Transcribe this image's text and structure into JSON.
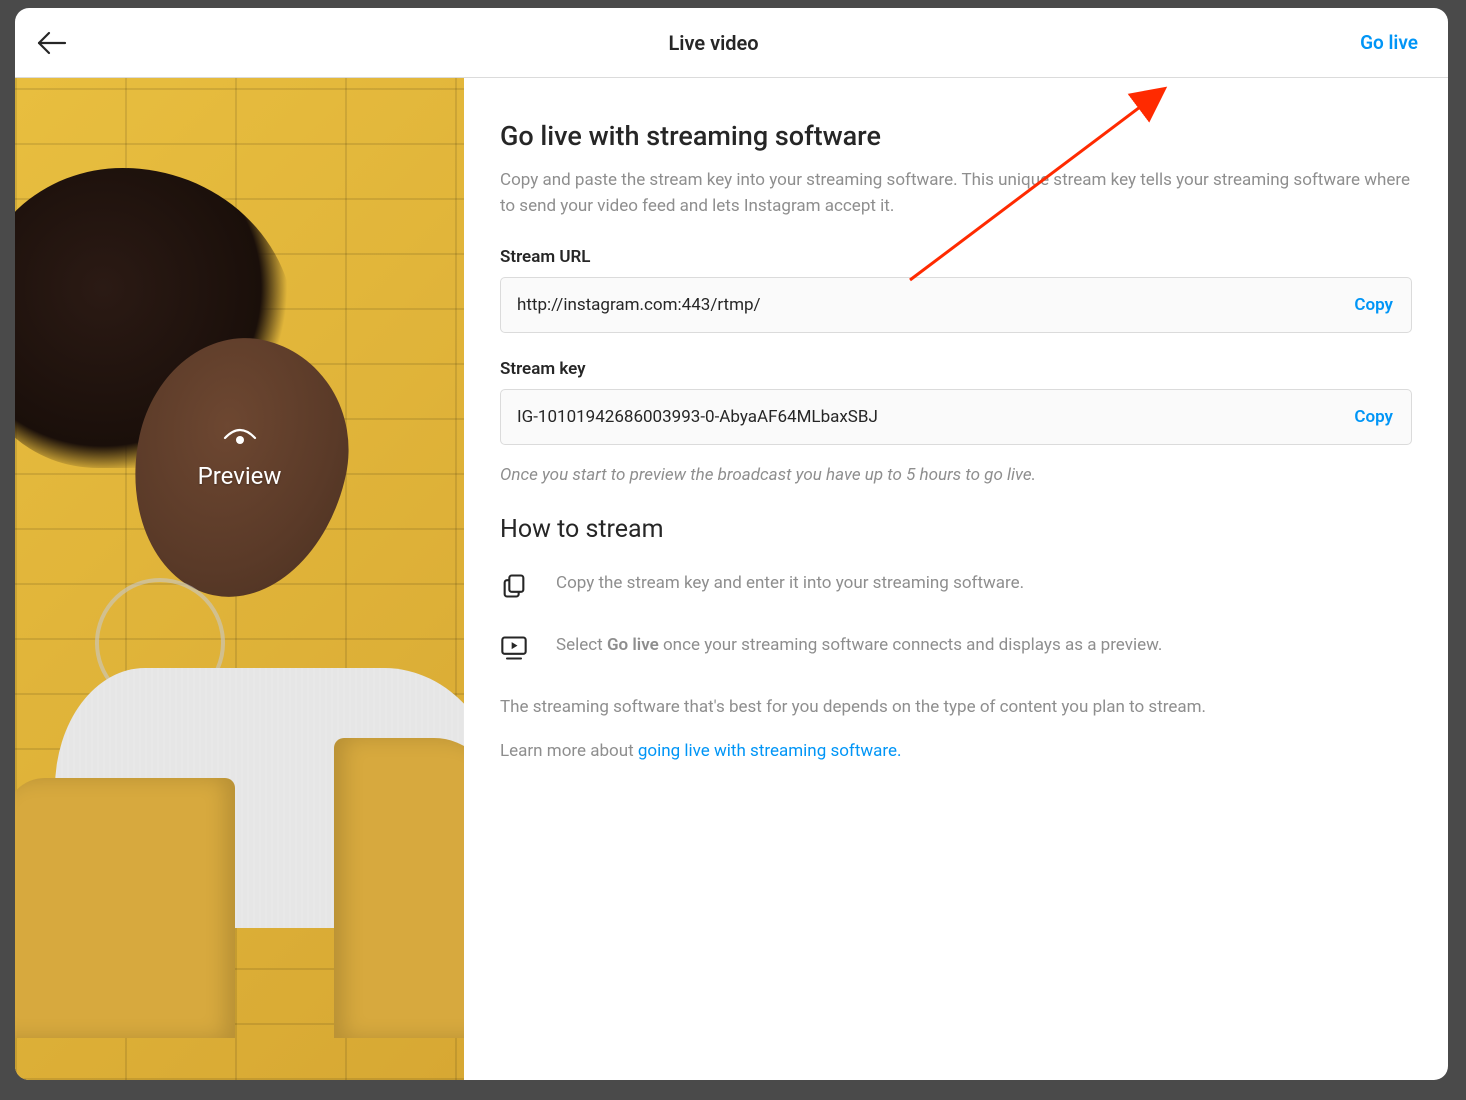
{
  "header": {
    "title": "Live video",
    "go_live_label": "Go live"
  },
  "preview": {
    "label": "Preview"
  },
  "section": {
    "heading": "Go live with streaming software",
    "description": "Copy and paste the stream key into your streaming software. This unique stream key tells your streaming software where to send your video feed and lets Instagram accept it."
  },
  "fields": {
    "stream_url_label": "Stream URL",
    "stream_url_value": "http://instagram.com:443/rtmp/",
    "stream_key_label": "Stream key",
    "stream_key_value": "IG-10101942686003993-0-AbyaAF64MLbaxSBJ",
    "copy_label": "Copy"
  },
  "note": "Once you start to preview the broadcast you have up to 5 hours to go live.",
  "how_to": {
    "heading": "How to stream",
    "step1": "Copy the stream key and enter it into your streaming software.",
    "step2_prefix": "Select ",
    "step2_bold": "Go live",
    "step2_suffix": " once your streaming software connects and displays as a preview."
  },
  "footer": {
    "paragraph": "The streaming software that's best for you depends on the type of content you plan to stream.",
    "learn_prefix": "Learn more about ",
    "learn_link": "going live with streaming software."
  }
}
